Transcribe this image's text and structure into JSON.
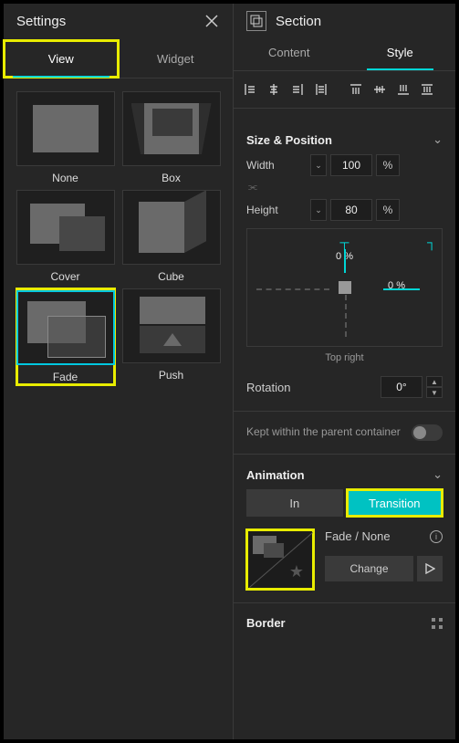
{
  "settings": {
    "title": "Settings",
    "tabs": {
      "view": "View",
      "widget": "Widget"
    },
    "effects": [
      {
        "key": "none",
        "label": "None"
      },
      {
        "key": "box",
        "label": "Box"
      },
      {
        "key": "cover",
        "label": "Cover"
      },
      {
        "key": "cube",
        "label": "Cube"
      },
      {
        "key": "fade",
        "label": "Fade"
      },
      {
        "key": "push",
        "label": "Push"
      }
    ],
    "selected_effect": "fade"
  },
  "section": {
    "title": "Section",
    "tabs": {
      "content": "Content",
      "style": "Style"
    },
    "size_position": {
      "heading": "Size & Position",
      "width_label": "Width",
      "width_value": "100",
      "width_unit": "%",
      "height_label": "Height",
      "height_value": "80",
      "height_unit": "%",
      "anchor_top": "0",
      "anchor_top_unit": "%",
      "anchor_right": "0",
      "anchor_right_unit": "%",
      "anchor_caption": "Top right",
      "rotation_label": "Rotation",
      "rotation_value": "0°"
    },
    "kept_within": "Kept within the parent container",
    "animation": {
      "heading": "Animation",
      "in": "In",
      "transition": "Transition",
      "fade_none": "Fade / None",
      "change": "Change"
    },
    "border": {
      "heading": "Border"
    }
  }
}
